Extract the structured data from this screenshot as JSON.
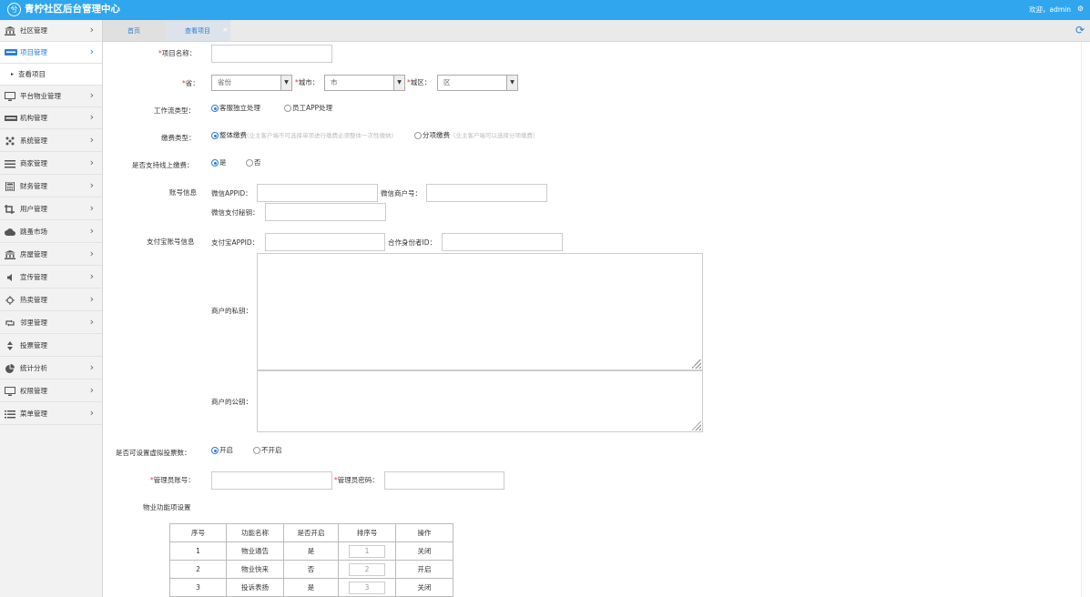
{
  "header": {
    "logo": "兮",
    "title": "青柠社区后台管理中心",
    "welcome": "欢迎，admin",
    "gear": "⚙"
  },
  "sidebar": {
    "items": [
      {
        "label": "社区管理",
        "icon": "bank-icon"
      },
      {
        "label": "项目管理",
        "icon": "project-card-icon",
        "active": true
      },
      {
        "label": "平台物业管理",
        "icon": "monitor-icon"
      },
      {
        "label": "机构管理",
        "icon": "org-icon"
      },
      {
        "label": "系统管理",
        "icon": "dots-icon"
      },
      {
        "label": "商家管理",
        "icon": "list-bars-icon"
      },
      {
        "label": "财务管理",
        "icon": "calculator-icon"
      },
      {
        "label": "用户管理",
        "icon": "crop-icon"
      },
      {
        "label": "跳蚤市场",
        "icon": "cloud-icon"
      },
      {
        "label": "房屋管理",
        "icon": "house-bank-icon"
      },
      {
        "label": "宣传管理",
        "icon": "speaker-icon"
      },
      {
        "label": "热卖管理",
        "icon": "sun-icon"
      },
      {
        "label": "邻里管理",
        "icon": "retweet-icon"
      },
      {
        "label": "投票管理",
        "icon": "sort-icon"
      },
      {
        "label": "统计分析",
        "icon": "pie-icon"
      },
      {
        "label": "权限管理",
        "icon": "desktop-icon"
      },
      {
        "label": "菜单管理",
        "icon": "menu-list-icon"
      }
    ],
    "sub_item": "查看项目"
  },
  "tabs": {
    "home": "首页",
    "view": "查看项目",
    "close": "×",
    "refresh": "⟳"
  },
  "form": {
    "project_name": {
      "label": "项目名称：",
      "required": "*",
      "value": ""
    },
    "province": {
      "label": "省：",
      "required": "*",
      "value": "省份"
    },
    "city": {
      "label": "城市：",
      "required": "*",
      "value": "市"
    },
    "district": {
      "label": "城区：",
      "required": "*",
      "value": "区"
    },
    "workflow": {
      "label": "工作流类型：",
      "options": [
        "客服独立处理",
        "员工APP处理"
      ],
      "selected": 0
    },
    "fee_type": {
      "label": "缴费类型：",
      "opt1": "整体缴费",
      "hint1": "(业主客户端不可选择单项进行缴费必须整体一次性缴纳)",
      "opt2": "分项缴费",
      "hint2": "（业主客户端可以选择分项缴费）"
    },
    "online_pay": {
      "label": "是否支持线上缴费：",
      "options": [
        "是",
        "否"
      ]
    },
    "account": {
      "label": "账号信息",
      "wx_appid": "微信APPID：",
      "wx_mch": "微信商户号：",
      "wx_secret": "微信支付秘钥："
    },
    "alipay": {
      "label": "支付宝账号信息",
      "appid": "支付宝APPID：",
      "partner": "合作身份者ID：",
      "private_key": "商户的私钥：",
      "public_key": "商户的公钥："
    },
    "virtual_vote": {
      "label": "是否可设置虚拟投票数：",
      "options": [
        "开启",
        "不开启"
      ]
    },
    "admin_account": {
      "label": "管理员账号：",
      "required": "*"
    },
    "admin_password": {
      "label": "管理员密码：",
      "required": "*"
    },
    "func_setting": {
      "label": "物业功能项设置"
    }
  },
  "func_table": {
    "headers": [
      "序号",
      "功能名称",
      "是否开启",
      "排序号",
      "操作"
    ],
    "rows": [
      [
        "1",
        "物业通告",
        "是",
        "1",
        "关闭"
      ],
      [
        "2",
        "物业快来",
        "否",
        "2",
        "开启"
      ],
      [
        "3",
        "投诉表扬",
        "是",
        "3",
        "关闭"
      ]
    ]
  },
  "colors": {
    "header_bg": "#2fa6ee",
    "accent": "#2a7fd4",
    "required": "#ee3333"
  }
}
